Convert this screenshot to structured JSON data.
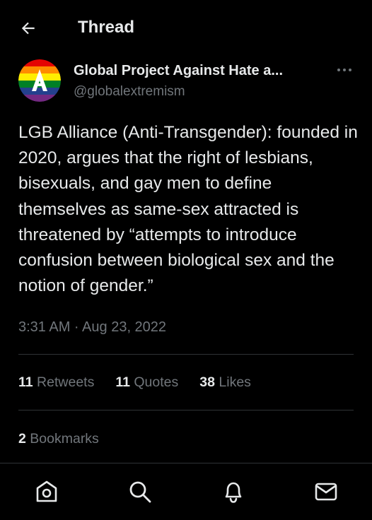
{
  "header": {
    "title": "Thread",
    "back_icon": "arrow-left-icon"
  },
  "author": {
    "name": "Global Project Against Hate a...",
    "handle": "@globalextremism",
    "avatar_icon": "rainbow-logo-icon",
    "more_icon": "more-horizontal-icon"
  },
  "tweet": {
    "text": "LGB Alliance (Anti-Transgender): founded in 2020, argues that the right of lesbians, bisexuals, and gay men to define themselves as same-sex attracted is threatened by “attempts to introduce confusion between biological sex and the notion of gender.”",
    "timestamp": "3:31 AM · Aug 23, 2022"
  },
  "stats": {
    "retweets_count": "11",
    "retweets_label": "Retweets",
    "quotes_count": "11",
    "quotes_label": "Quotes",
    "likes_count": "38",
    "likes_label": "Likes",
    "bookmarks_count": "2",
    "bookmarks_label": "Bookmarks"
  },
  "nav": {
    "items": [
      {
        "icon": "home-icon"
      },
      {
        "icon": "search-icon"
      },
      {
        "icon": "bell-icon"
      },
      {
        "icon": "mail-icon"
      }
    ]
  },
  "colors": {
    "background": "#000000",
    "text": "#e7e9ea",
    "secondary_text": "#71767b",
    "divider": "#2f3336"
  }
}
